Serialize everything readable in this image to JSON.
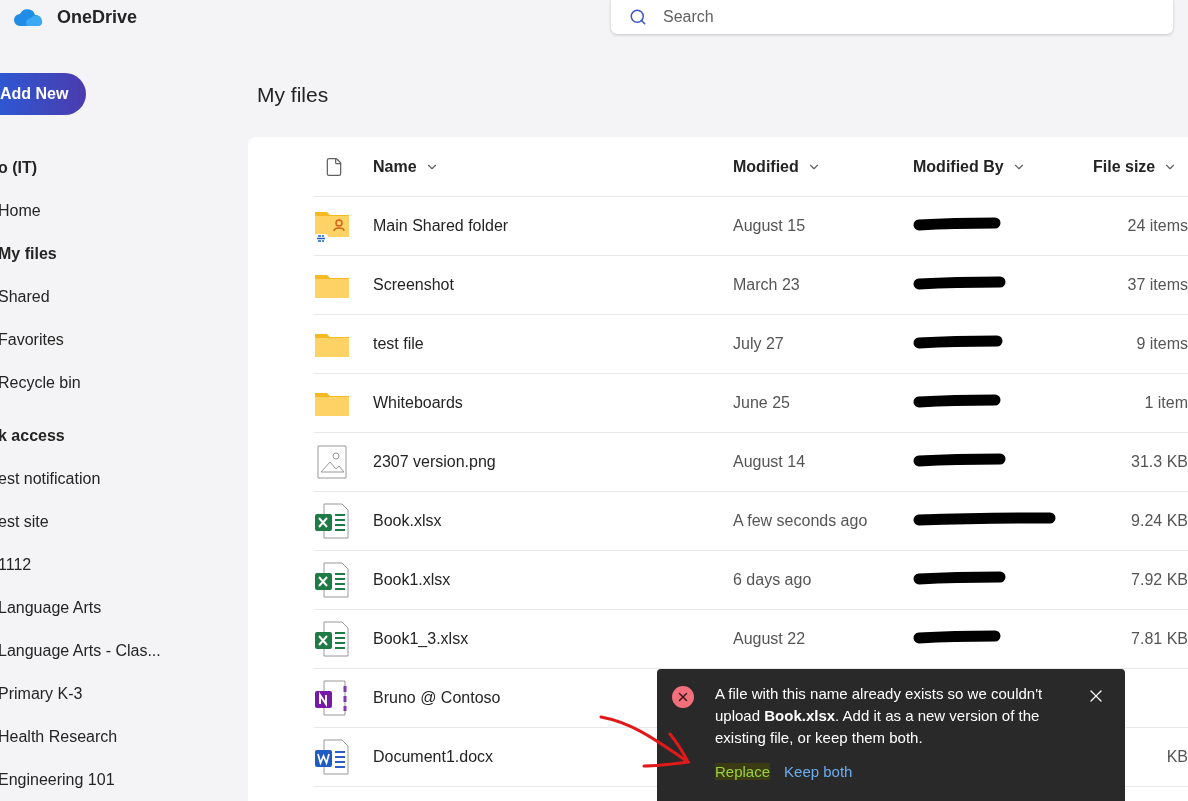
{
  "app": {
    "name": "OneDrive"
  },
  "search": {
    "placeholder": "Search"
  },
  "sidebar": {
    "add_button": "Add New",
    "items": [
      {
        "label": "o (IT)",
        "kind": "heading"
      },
      {
        "label": "Home",
        "kind": "link",
        "selected": false
      },
      {
        "label": "My files",
        "kind": "link",
        "selected": true
      },
      {
        "label": "Shared",
        "kind": "link",
        "selected": false
      },
      {
        "label": "Favorites",
        "kind": "link",
        "selected": false
      },
      {
        "label": "Recycle bin",
        "kind": "link",
        "selected": false
      },
      {
        "label": "k access",
        "kind": "heading"
      },
      {
        "label": "est notification",
        "kind": "link",
        "selected": false
      },
      {
        "label": "est site",
        "kind": "link",
        "selected": false
      },
      {
        "label": "1112",
        "kind": "link",
        "selected": false
      },
      {
        "label": "Language Arts",
        "kind": "link",
        "selected": false
      },
      {
        "label": "Language Arts - Clas...",
        "kind": "link",
        "selected": false
      },
      {
        "label": "Primary K-3",
        "kind": "link",
        "selected": false
      },
      {
        "label": "Health Research",
        "kind": "link",
        "selected": false
      },
      {
        "label": "Engineering 101",
        "kind": "link",
        "selected": false
      }
    ]
  },
  "page_title": "My files",
  "table": {
    "columns": [
      "Name",
      "Modified",
      "Modified By",
      "File size"
    ],
    "rows": [
      {
        "kind": "shared-folder",
        "name": "Main Shared folder",
        "modified": "August 15",
        "modified_by_redacted": true,
        "size": "24 items"
      },
      {
        "kind": "folder",
        "name": "Screenshot",
        "modified": "March 23",
        "modified_by_redacted": true,
        "size": "37 items"
      },
      {
        "kind": "folder",
        "name": "test file",
        "modified": "July 27",
        "modified_by_redacted": true,
        "size": "9 items"
      },
      {
        "kind": "folder",
        "name": "Whiteboards",
        "modified": "June 25",
        "modified_by_redacted": true,
        "size": "1 item"
      },
      {
        "kind": "image",
        "name": "2307 version.png",
        "modified": "August 14",
        "modified_by_redacted": true,
        "size": "31.3 KB"
      },
      {
        "kind": "excel",
        "name": "Book.xlsx",
        "modified": "A few seconds ago",
        "modified_by_redacted": true,
        "size": "9.24 KB"
      },
      {
        "kind": "excel",
        "name": "Book1.xlsx",
        "modified": "6 days ago",
        "modified_by_redacted": true,
        "size": "7.92 KB"
      },
      {
        "kind": "excel",
        "name": "Book1_3.xlsx",
        "modified": "August 22",
        "modified_by_redacted": true,
        "size": "7.81 KB"
      },
      {
        "kind": "onenote",
        "name": "Bruno @ Contoso"
      },
      {
        "kind": "word",
        "name": "Document1.docx",
        "size": "KB"
      }
    ]
  },
  "toast": {
    "message": "A file with this name already exists so we couldn't upload **Book.xlsx**. Add it as a new version of the existing file, or keep them both.",
    "actions": [
      {
        "label": "Replace",
        "kind": "primary"
      },
      {
        "label": "Keep both",
        "kind": "secondary"
      }
    ]
  }
}
